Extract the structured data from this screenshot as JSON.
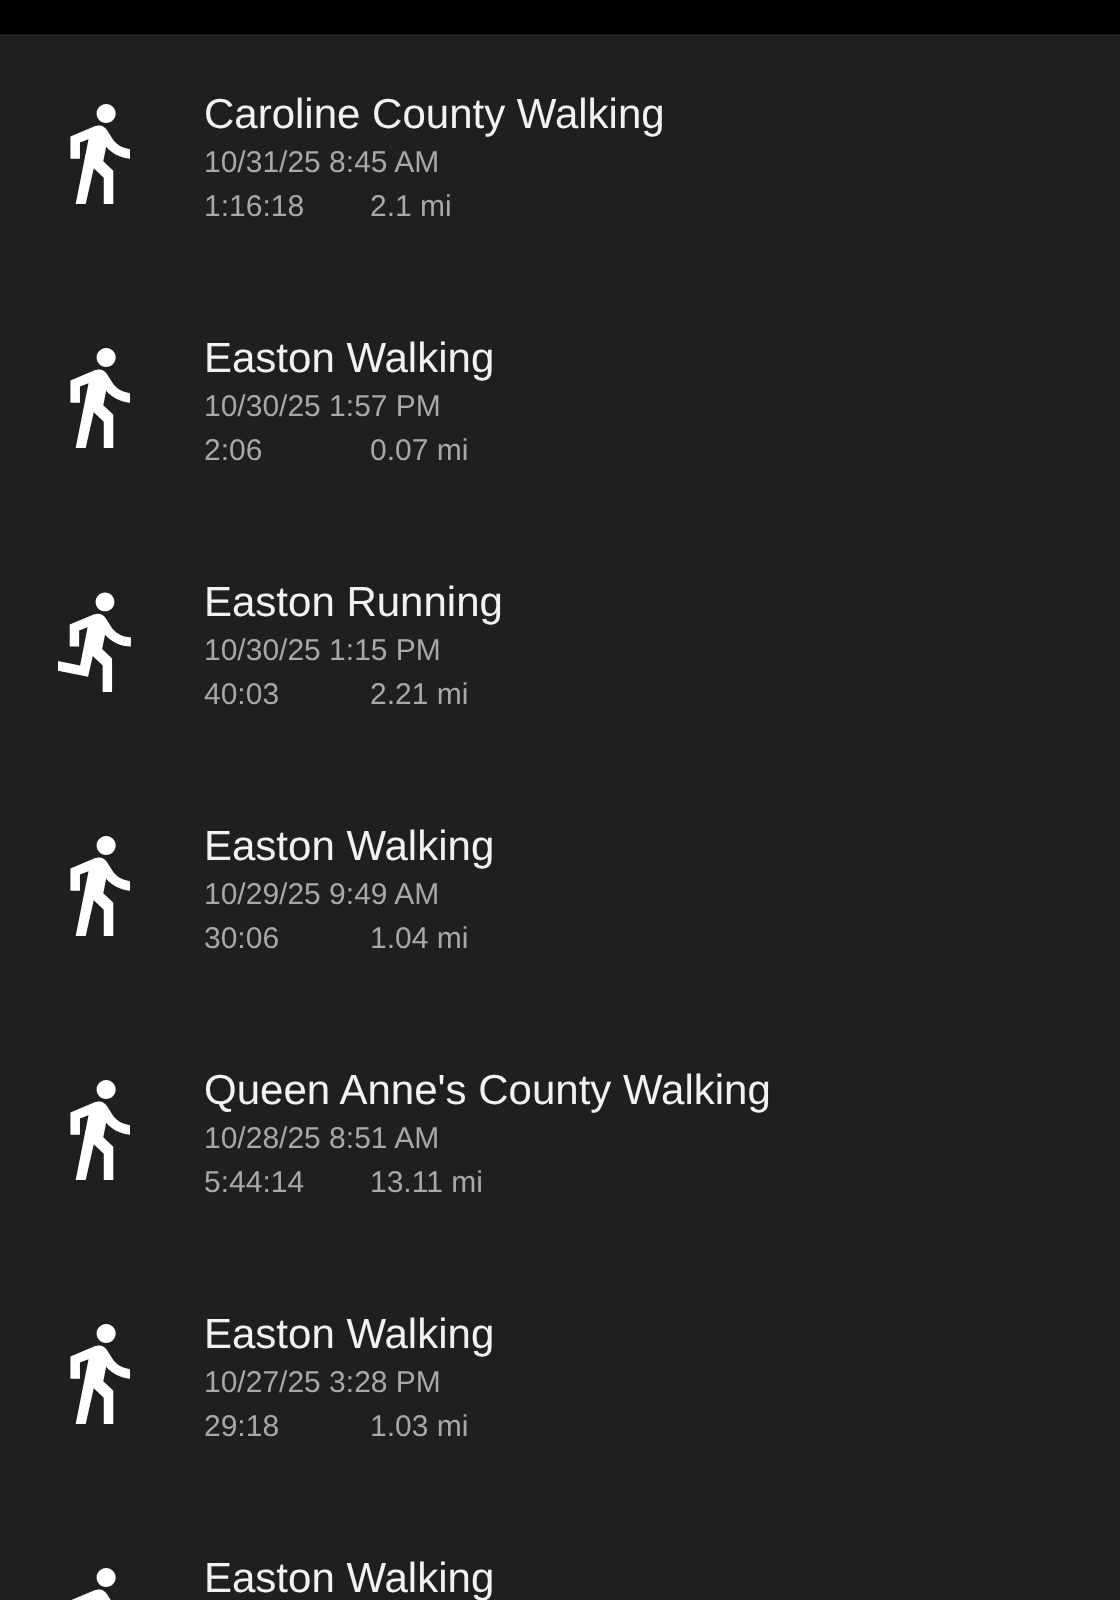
{
  "activities": [
    {
      "kind": "walking",
      "title": "Caroline County Walking",
      "date": "10/31/25 8:45 AM",
      "duration": "1:16:18",
      "distance": "2.1 mi"
    },
    {
      "kind": "walking",
      "title": "Easton Walking",
      "date": "10/30/25 1:57 PM",
      "duration": "2:06",
      "distance": "0.07 mi"
    },
    {
      "kind": "running",
      "title": "Easton Running",
      "date": "10/30/25 1:15 PM",
      "duration": "40:03",
      "distance": "2.21 mi"
    },
    {
      "kind": "walking",
      "title": "Easton Walking",
      "date": "10/29/25 9:49 AM",
      "duration": "30:06",
      "distance": "1.04 mi"
    },
    {
      "kind": "walking",
      "title": "Queen Anne's County Walking",
      "date": "10/28/25 8:51 AM",
      "duration": "5:44:14",
      "distance": "13.11 mi"
    },
    {
      "kind": "walking",
      "title": "Easton Walking",
      "date": "10/27/25 3:28 PM",
      "duration": "29:18",
      "distance": "1.03 mi"
    },
    {
      "kind": "walking",
      "title": "Easton Walking"
    }
  ]
}
